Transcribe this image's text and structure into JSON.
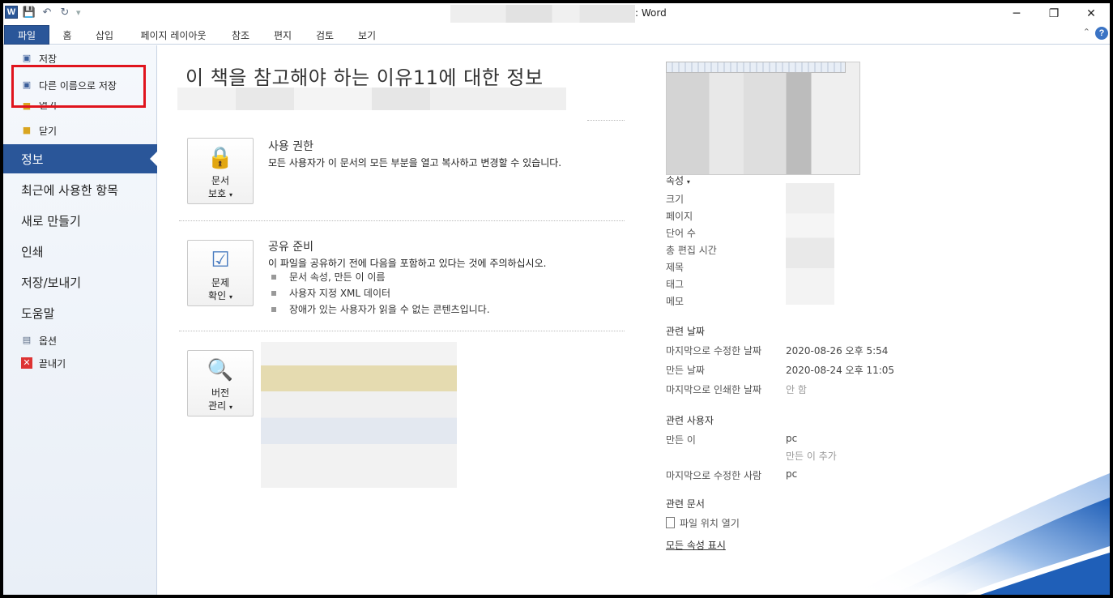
{
  "titlebar": {
    "app_letter": "W",
    "title": ": Word"
  },
  "tabs": [
    "파일",
    "홈",
    "삽입",
    "페이지 레이아웃",
    "참조",
    "편지",
    "검토",
    "보기"
  ],
  "nav": {
    "small_items": [
      "저장",
      "다른 이름으로 저장",
      "열기",
      "닫기"
    ],
    "big_items": [
      "정보",
      "최근에 사용한 항목",
      "새로 만들기",
      "인쇄",
      "저장/보내기",
      "도움말"
    ],
    "bottom_items": [
      "옵션",
      "끝내기"
    ]
  },
  "main": {
    "title": "이 책을 참고해야 하는 이유11에 대한 정보",
    "permissions": {
      "button": [
        "문서",
        "보호"
      ],
      "heading": "사용 권한",
      "desc": "모든 사용자가 이 문서의 모든 부분을 열고 복사하고 변경할 수 있습니다."
    },
    "prepare": {
      "button": [
        "문제",
        "확인"
      ],
      "heading": "공유 준비",
      "desc": "이 파일을 공유하기 전에 다음을 포함하고 있다는 것에 주의하십시오.",
      "bullets": [
        "문서 속성, 만든 이 이름",
        "사용자 지정 XML 데이터",
        "장애가 있는 사용자가 읽을 수 없는 콘텐츠입니다."
      ]
    },
    "versions": {
      "button": [
        "버전",
        "관리"
      ]
    }
  },
  "right": {
    "properties_label": "속성",
    "property_keys": [
      "크기",
      "페이지",
      "단어 수",
      "총 편집 시간",
      "제목",
      "태그",
      "메모"
    ],
    "related_dates_label": "관련 날짜",
    "dates": [
      {
        "key": "마지막으로 수정한 날짜",
        "value": "2020-08-26 오후 5:54"
      },
      {
        "key": "만든 날짜",
        "value": "2020-08-24 오후 11:05"
      },
      {
        "key": "마지막으로 인쇄한 날짜",
        "value": "안 함"
      }
    ],
    "related_people_label": "관련 사용자",
    "author_key": "만든 이",
    "author_value": "pc",
    "add_author": "만든 이 추가",
    "last_modified_by_key": "마지막으로 수정한 사람",
    "last_modified_by_value": "pc",
    "related_docs_label": "관련 문서",
    "open_location": "파일 위치 열기",
    "show_all": "모든 속성 표시"
  }
}
